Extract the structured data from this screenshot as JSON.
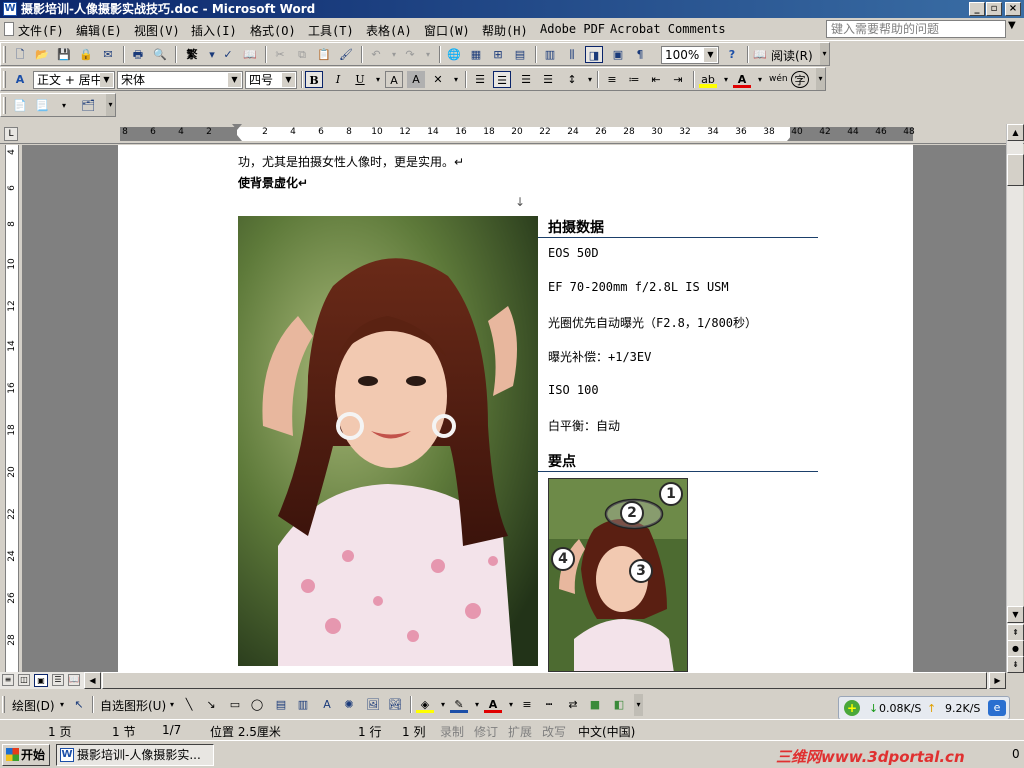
{
  "window": {
    "title": "摄影培训-人像摄影实战技巧.doc - Microsoft Word",
    "app_icon": "W"
  },
  "menu": {
    "items": [
      "文件(F)",
      "编辑(E)",
      "视图(V)",
      "插入(I)",
      "格式(O)",
      "工具(T)",
      "表格(A)",
      "窗口(W)",
      "帮助(H)",
      "Adobe PDF",
      "Acrobat Comments"
    ],
    "help_placeholder": "键入需要帮助的问题"
  },
  "toolbar_standard": {
    "zoom": "100%",
    "read_label": "阅读(R)"
  },
  "toolbar_format": {
    "style": "正文 + 居中",
    "font": "宋体",
    "size": "四号",
    "bold": "B",
    "italic": "I",
    "underline": "U"
  },
  "ruler": {
    "h_numbers": [
      "8",
      "6",
      "4",
      "2",
      "2",
      "4",
      "6",
      "8",
      "10",
      "12",
      "14",
      "16",
      "18",
      "20",
      "22",
      "24",
      "26",
      "28",
      "30",
      "32",
      "34",
      "36",
      "38",
      "40",
      "42",
      "44",
      "46",
      "48"
    ],
    "v_numbers": [
      "4",
      "6",
      "8",
      "10",
      "12",
      "14",
      "16",
      "18",
      "20",
      "22",
      "24",
      "26",
      "28"
    ]
  },
  "document": {
    "line1": "功，尤其是拍摄女性人像时，更是实用。↵",
    "line2": "使背景虚化↵",
    "arrow": "↓",
    "section1_title": "拍摄数据",
    "data_lines": [
      "EOS 50D",
      "EF 70-200mm f/2.8L IS USM",
      "光圈优先自动曝光（F2.8，1/800秒）",
      "曝光补偿：+1/3EV",
      "ISO 100",
      "白平衡：自动"
    ],
    "section2_title": "要点",
    "callouts": [
      "1",
      "2",
      "3",
      "4"
    ]
  },
  "drawbar": {
    "draw_label": "绘图(D)",
    "autoshape_label": "自选图形(U)"
  },
  "netmeter": {
    "down": "0.08K/S",
    "up": "9.2K/S"
  },
  "status": {
    "page": "1 页",
    "section": "1 节",
    "pages": "1/7",
    "position": "位置 2.5厘米",
    "line": "1 行",
    "column": "1 列",
    "rec": "录制",
    "trk": "修订",
    "ext": "扩展",
    "ovr": "改写",
    "lang": "中文(中国)"
  },
  "taskbar": {
    "start": "开始",
    "task_item": "摄影培训-人像摄影实...",
    "watermark": "三维网www.3dportal.cn",
    "clock_partial": "0"
  },
  "colors": {
    "titlebar_start": "#0a246a",
    "titlebar_end": "#3a6ea5",
    "heading_rule": "#1b3f6a"
  }
}
